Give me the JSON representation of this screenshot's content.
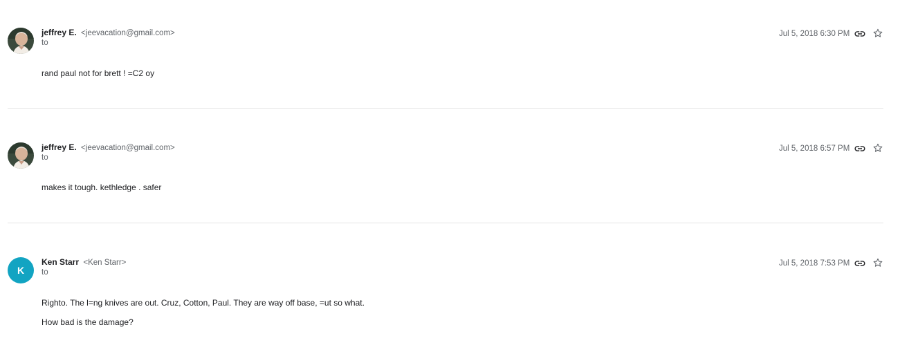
{
  "messages": [
    {
      "sender": "jeffrey E.",
      "email": "<jeevacation@gmail.com>",
      "to": "to",
      "date": "Jul 5, 2018 6:30 PM",
      "body": [
        "rand paul not for brett ! =C2 oy"
      ]
    },
    {
      "sender": "jeffrey E.",
      "email": "<jeevacation@gmail.com>",
      "to": "to",
      "date": "Jul 5, 2018 6:57 PM",
      "body": [
        "makes it tough. kethledge . safer"
      ]
    },
    {
      "sender": "Ken Starr",
      "email": "<Ken Starr>",
      "to": "to",
      "avatar_letter": "K",
      "avatar_color": "#12a4c2",
      "date": "Jul 5, 2018 7:53 PM",
      "body": [
        "Righto. The l=ng knives are out. Cruz, Cotton, Paul. They are way off base, =ut so what.",
        "How bad is the damage?"
      ]
    }
  ],
  "icons": {
    "link": "link-icon",
    "star": "star-outline-icon"
  }
}
